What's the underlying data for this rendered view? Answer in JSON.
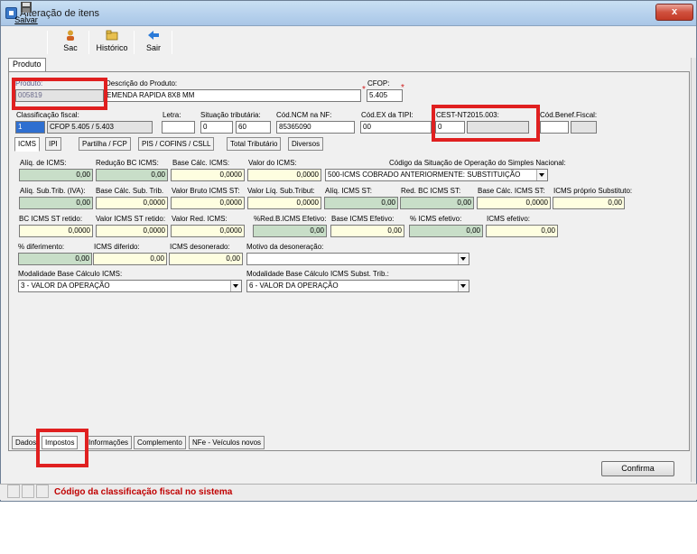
{
  "window": {
    "title": "Alteração de itens",
    "close_label": "x"
  },
  "toolbar": {
    "salvar": "Salvar",
    "sac": "Sac",
    "historico": "Histórico",
    "sair": "Sair"
  },
  "tabs_top": [
    "Produto"
  ],
  "produto": {
    "produto_label": "Produto:",
    "produto_value": "005819",
    "descricao_label": "Descrição do Produto:",
    "descricao_value": "EMENDA RAPIDA 8X8 MM",
    "cfop_label": "CFOP:",
    "cfop_value": "5.405",
    "asterisk": "*"
  },
  "classificacao": {
    "classificacao_label": "Classificação fiscal:",
    "classificacao_code": "1",
    "classificacao_value": "CFOP 5.405 / 5.403",
    "letra_label": "Letra:",
    "letra_value": "",
    "situacao_label": "Situação tributária:",
    "situacao_1": "0",
    "situacao_2": "60",
    "ncm_label": "Cód.NCM na NF:",
    "ncm_value": "85365090",
    "codex_label": "Cód.EX da TIPI:",
    "codex_value": "00",
    "cest_label": "CEST-NT2015.003:",
    "cest_value": "0",
    "cest_desc": "",
    "benef_label": "Cód.Benef.Fiscal:",
    "benef_value": ""
  },
  "subtabs": [
    "ICMS",
    "IPI",
    "Partilha / FCP",
    "PIS / COFINS / CSLL",
    "Total Tributário",
    "Diversos"
  ],
  "icms": {
    "aliq_icms_label": "Alíq. de ICMS:",
    "aliq_icms": "0,00",
    "red_bc_label": "Redução BC ICMS:",
    "red_bc": "0,00",
    "base_calc_label": "Base Cálc. ICMS:",
    "base_calc": "0,0000",
    "valor_icms_label": "Valor do ICMS:",
    "valor_icms": "0,0000",
    "csosn_label": "Código da Situação de Operação do Simples Nacional:",
    "csosn_value": "500-ICMS COBRADO ANTERIORMENTE: SUBSTITUIÇÃO",
    "aliq_st_label": "Alíq. Sub.Trib. (IVA):",
    "aliq_st": "0,00",
    "base_st_label": "Base Cálc. Sub. Trib.",
    "base_st": "0,0000",
    "vbruto_st_label": "Valor Bruto ICMS ST:",
    "vbruto_st": "0,0000",
    "vliq_st_label": "Valor Líq. Sub.Tribut:",
    "vliq_st": "0,0000",
    "aliq_icms_st_label": "Alíq. ICMS ST:",
    "aliq_icms_st": "0,00",
    "red_bc_st_label": "Red. BC ICMS ST:",
    "red_bc_st": "0,00",
    "base_icms_st_label": "Base Cálc. ICMS ST:",
    "base_icms_st": "0,0000",
    "icms_proprio_label": "ICMS próprio Substituto:",
    "icms_proprio": "0,00",
    "bc_retido_label": "BC ICMS ST retido:",
    "bc_retido": "0,0000",
    "v_retido_label": "Valor ICMS ST retido:",
    "v_retido": "0,0000",
    "v_red_label": "Valor Red. ICMS:",
    "v_red": "0,0000",
    "pred_efetivo_label": "%Red.B.ICMS Efetivo:",
    "pred_efetivo": "0,00",
    "base_efetivo_label": "Base ICMS Efetivo:",
    "base_efetivo": "0,00",
    "p_icms_efetivo_label": "% ICMS efetivo:",
    "p_icms_efetivo": "0,00",
    "icms_efetivo_label": "ICMS efetivo:",
    "icms_efetivo": "0,00",
    "diferimento_label": "% diferimento:",
    "diferimento": "0,00",
    "icms_diferido_label": "ICMS diferido:",
    "icms_diferido": "0,00",
    "icms_desonerado_label": "ICMS desonerado:",
    "icms_desonerado": "0,00",
    "motivo_label": "Motivo da desoneração:",
    "motivo_value": "",
    "mod_bc_label": "Modalidade Base Cálculo ICMS:",
    "mod_bc_value": "3 - VALOR DA OPERAÇÃO",
    "mod_bc_st_label": "Modalidade Base Cálculo ICMS Subst. Trib.:",
    "mod_bc_st_value": "6 - VALOR DA OPERAÇÃO"
  },
  "bottom_tabs": [
    "Dados",
    "Impostos",
    "Informações",
    "Complemento",
    "NFe - Veículos novos"
  ],
  "confirm_label": "Confirma",
  "status_message": "Código da classificação fiscal no sistema",
  "colors": {
    "highlight_box": "#e02020",
    "status_text": "#c00000",
    "readonly_green": "#c8dec8",
    "input_yellow": "#fefee0"
  }
}
